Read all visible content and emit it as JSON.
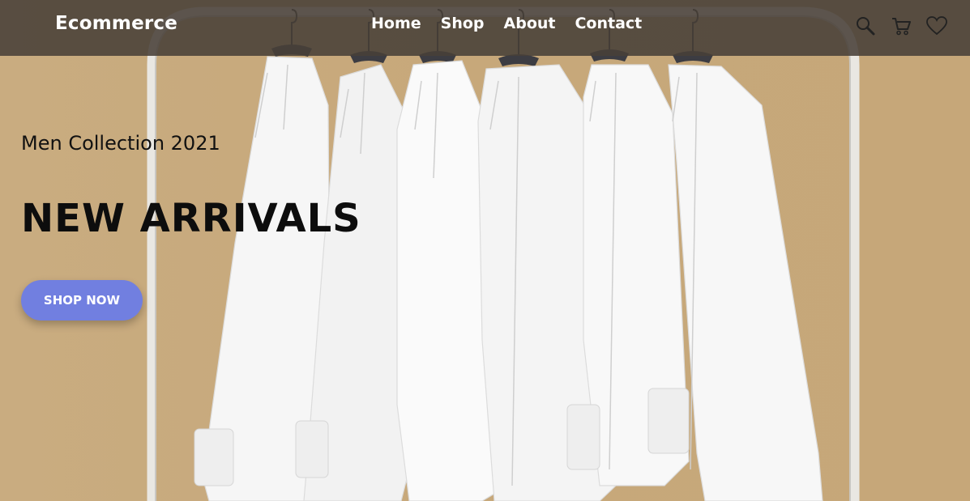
{
  "header": {
    "logo": "Ecommerce",
    "nav": [
      {
        "label": "Home"
      },
      {
        "label": "Shop"
      },
      {
        "label": "About"
      },
      {
        "label": "Contact"
      }
    ],
    "icons": [
      "search-icon",
      "cart-icon",
      "heart-icon"
    ]
  },
  "hero": {
    "subtitle": "Men Collection 2021",
    "title": "NEW ARRIVALS",
    "cta_label": "SHOP NOW",
    "background_image": "white shirts hanging on a clothes rack"
  },
  "colors": {
    "nav_bg": "#484038",
    "hero_bg": "#c8ab7e",
    "cta_bg": "#717fe0",
    "text_dark": "#0d0d0d",
    "text_light": "#ffffff"
  }
}
